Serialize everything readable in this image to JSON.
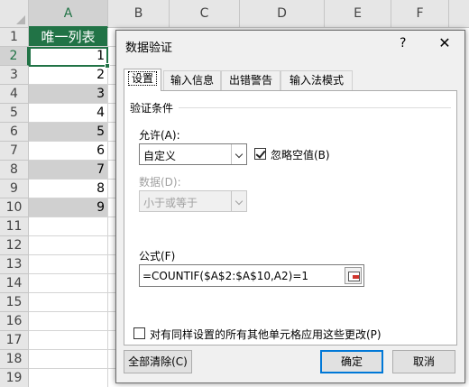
{
  "sheet": {
    "columns": [
      "A",
      "B",
      "C",
      "D",
      "E",
      "F"
    ],
    "rows": [
      "1",
      "2",
      "3",
      "4",
      "5",
      "6",
      "7",
      "8",
      "9",
      "10",
      "11",
      "12",
      "13",
      "14",
      "15",
      "16",
      "17",
      "18",
      "19"
    ],
    "header_cell": "唯一列表",
    "values": [
      "1",
      "2",
      "3",
      "4",
      "5",
      "6",
      "7",
      "8",
      "9"
    ],
    "colors": {
      "accent": "#217346",
      "stripe": "#d0d0d0"
    }
  },
  "dialog": {
    "title": "数据验证",
    "help": "?",
    "close": "✕",
    "tabs": [
      "设置",
      "输入信息",
      "出错警告",
      "输入法模式"
    ],
    "group_title": "验证条件",
    "allow_label": "允许(A):",
    "allow_value": "自定义",
    "ignore_blank_label": "忽略空值(B)",
    "ignore_blank_checked": true,
    "data_label": "数据(D):",
    "data_value": "小于或等于",
    "formula_label": "公式(F)",
    "formula_value": "=COUNTIF($A$2:$A$10,A2)=1",
    "apply_all_label": "对有同样设置的所有其他单元格应用这些更改(P)",
    "apply_all_checked": false,
    "clear_all": "全部清除(C)",
    "ok": "确定",
    "cancel": "取消"
  }
}
